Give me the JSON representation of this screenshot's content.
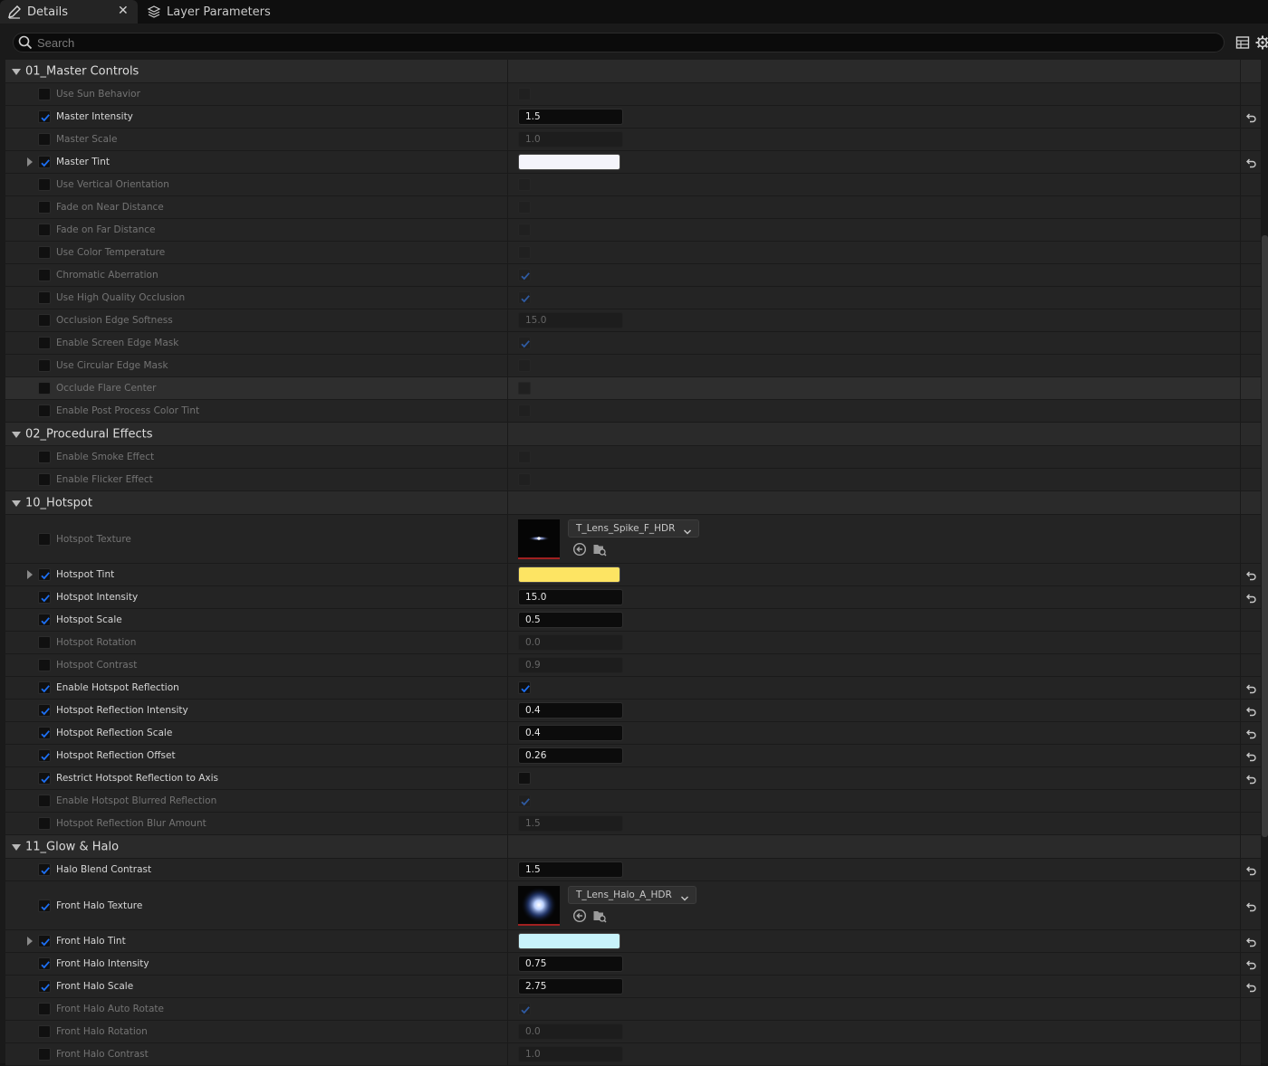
{
  "tabs": [
    {
      "label": "Details",
      "icon": "pencil-icon",
      "active": true
    },
    {
      "label": "Layer Parameters",
      "icon": "layers-icon",
      "active": false
    }
  ],
  "search": {
    "placeholder": "Search",
    "value": ""
  },
  "colors": {
    "accent": "#1d6ff2",
    "background": "#1a1a1a",
    "row": "#242424"
  },
  "rows": [
    {
      "type": "category",
      "label": "01_Master Controls"
    },
    {
      "type": "param",
      "label": "Use Sun Behavior",
      "enabled": false,
      "kind": "bool",
      "checked": false
    },
    {
      "type": "param",
      "label": "Master Intensity",
      "enabled": true,
      "kind": "number",
      "value": "1.5",
      "reset": true
    },
    {
      "type": "param",
      "label": "Master Scale",
      "enabled": false,
      "kind": "number",
      "value": "1.0"
    },
    {
      "type": "param",
      "label": "Master Tint",
      "enabled": true,
      "kind": "color",
      "color": "#f4f4fb",
      "expandable": true,
      "reset": true
    },
    {
      "type": "param",
      "label": "Use Vertical Orientation",
      "enabled": false,
      "kind": "bool",
      "checked": false
    },
    {
      "type": "param",
      "label": "Fade on Near Distance",
      "enabled": false,
      "kind": "bool",
      "checked": false
    },
    {
      "type": "param",
      "label": "Fade on Far Distance",
      "enabled": false,
      "kind": "bool",
      "checked": false
    },
    {
      "type": "param",
      "label": "Use Color Temperature",
      "enabled": false,
      "kind": "bool",
      "checked": false
    },
    {
      "type": "param",
      "label": "Chromatic Aberration",
      "enabled": false,
      "kind": "bool",
      "checked": true
    },
    {
      "type": "param",
      "label": "Use High Quality Occlusion",
      "enabled": false,
      "kind": "bool",
      "checked": true
    },
    {
      "type": "param",
      "label": "Occlusion Edge Softness",
      "enabled": false,
      "kind": "number",
      "value": "15.0"
    },
    {
      "type": "param",
      "label": "Enable Screen Edge Mask",
      "enabled": false,
      "kind": "bool",
      "checked": true
    },
    {
      "type": "param",
      "label": "Use Circular Edge Mask",
      "enabled": false,
      "kind": "bool",
      "checked": false
    },
    {
      "type": "param",
      "label": "Occlude Flare Center",
      "enabled": false,
      "kind": "bool",
      "checked": false,
      "highlight": true
    },
    {
      "type": "param",
      "label": "Enable Post Process Color Tint",
      "enabled": false,
      "kind": "bool",
      "checked": false
    },
    {
      "type": "category",
      "label": "02_Procedural Effects"
    },
    {
      "type": "param",
      "label": "Enable Smoke Effect",
      "enabled": false,
      "kind": "bool",
      "checked": false
    },
    {
      "type": "param",
      "label": "Enable Flicker Effect",
      "enabled": false,
      "kind": "bool",
      "checked": false
    },
    {
      "type": "category",
      "label": "10_Hotspot"
    },
    {
      "type": "param",
      "label": "Hotspot Texture",
      "enabled": false,
      "kind": "texture",
      "asset": "T_Lens_Spike_F_HDR",
      "thumb": "spike"
    },
    {
      "type": "param",
      "label": "Hotspot Tint",
      "enabled": true,
      "kind": "color",
      "color": "#fde463",
      "expandable": true,
      "reset": true
    },
    {
      "type": "param",
      "label": "Hotspot Intensity",
      "enabled": true,
      "kind": "number",
      "value": "15.0",
      "reset": true
    },
    {
      "type": "param",
      "label": "Hotspot Scale",
      "enabled": true,
      "kind": "number",
      "value": "0.5"
    },
    {
      "type": "param",
      "label": "Hotspot Rotation",
      "enabled": false,
      "kind": "number",
      "value": "0.0"
    },
    {
      "type": "param",
      "label": "Hotspot Contrast",
      "enabled": false,
      "kind": "number",
      "value": "0.9"
    },
    {
      "type": "param",
      "label": "Enable Hotspot Reflection",
      "enabled": true,
      "kind": "bool",
      "checked": true,
      "reset": true
    },
    {
      "type": "param",
      "label": "Hotspot Reflection Intensity",
      "enabled": true,
      "kind": "number",
      "value": "0.4",
      "reset": true
    },
    {
      "type": "param",
      "label": "Hotspot Reflection Scale",
      "enabled": true,
      "kind": "number",
      "value": "0.4",
      "reset": true
    },
    {
      "type": "param",
      "label": "Hotspot Reflection Offset",
      "enabled": true,
      "kind": "number",
      "value": "0.26",
      "reset": true
    },
    {
      "type": "param",
      "label": "Restrict Hotspot Reflection to Axis",
      "enabled": true,
      "kind": "bool",
      "checked": false,
      "reset": true
    },
    {
      "type": "param",
      "label": "Enable Hotspot Blurred Reflection",
      "enabled": false,
      "kind": "bool",
      "checked": true
    },
    {
      "type": "param",
      "label": "Hotspot Reflection Blur Amount",
      "enabled": false,
      "kind": "number",
      "value": "1.5"
    },
    {
      "type": "category",
      "label": "11_Glow & Halo"
    },
    {
      "type": "param",
      "label": "Halo Blend Contrast",
      "enabled": true,
      "kind": "number",
      "value": "1.5",
      "reset": true
    },
    {
      "type": "param",
      "label": "Front Halo Texture",
      "enabled": true,
      "kind": "texture",
      "asset": "T_Lens_Halo_A_HDR",
      "thumb": "halo",
      "reset": true
    },
    {
      "type": "param",
      "label": "Front Halo Tint",
      "enabled": true,
      "kind": "color",
      "color": "#c8f3fb",
      "expandable": true,
      "reset": true
    },
    {
      "type": "param",
      "label": "Front Halo Intensity",
      "enabled": true,
      "kind": "number",
      "value": "0.75",
      "reset": true
    },
    {
      "type": "param",
      "label": "Front Halo Scale",
      "enabled": true,
      "kind": "number",
      "value": "2.75",
      "reset": true
    },
    {
      "type": "param",
      "label": "Front Halo Auto Rotate",
      "enabled": false,
      "kind": "bool",
      "checked": true
    },
    {
      "type": "param",
      "label": "Front Halo Rotation",
      "enabled": false,
      "kind": "number",
      "value": "0.0"
    },
    {
      "type": "param",
      "label": "Front Halo Contrast",
      "enabled": false,
      "kind": "number",
      "value": "1.0"
    }
  ]
}
